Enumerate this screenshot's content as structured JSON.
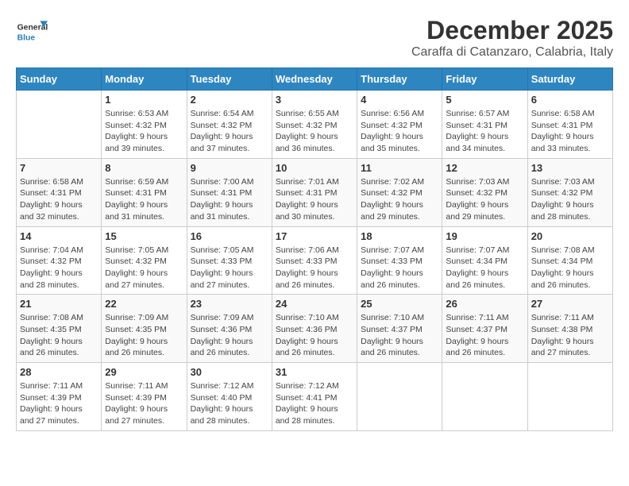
{
  "header": {
    "logo_general": "General",
    "logo_blue": "Blue",
    "title": "December 2025",
    "subtitle": "Caraffa di Catanzaro, Calabria, Italy"
  },
  "days_of_week": [
    "Sunday",
    "Monday",
    "Tuesday",
    "Wednesday",
    "Thursday",
    "Friday",
    "Saturday"
  ],
  "weeks": [
    [
      {
        "day": "",
        "info": ""
      },
      {
        "day": "1",
        "info": "Sunrise: 6:53 AM\nSunset: 4:32 PM\nDaylight: 9 hours\nand 39 minutes."
      },
      {
        "day": "2",
        "info": "Sunrise: 6:54 AM\nSunset: 4:32 PM\nDaylight: 9 hours\nand 37 minutes."
      },
      {
        "day": "3",
        "info": "Sunrise: 6:55 AM\nSunset: 4:32 PM\nDaylight: 9 hours\nand 36 minutes."
      },
      {
        "day": "4",
        "info": "Sunrise: 6:56 AM\nSunset: 4:32 PM\nDaylight: 9 hours\nand 35 minutes."
      },
      {
        "day": "5",
        "info": "Sunrise: 6:57 AM\nSunset: 4:31 PM\nDaylight: 9 hours\nand 34 minutes."
      },
      {
        "day": "6",
        "info": "Sunrise: 6:58 AM\nSunset: 4:31 PM\nDaylight: 9 hours\nand 33 minutes."
      }
    ],
    [
      {
        "day": "7",
        "info": "Sunrise: 6:58 AM\nSunset: 4:31 PM\nDaylight: 9 hours\nand 32 minutes."
      },
      {
        "day": "8",
        "info": "Sunrise: 6:59 AM\nSunset: 4:31 PM\nDaylight: 9 hours\nand 31 minutes."
      },
      {
        "day": "9",
        "info": "Sunrise: 7:00 AM\nSunset: 4:31 PM\nDaylight: 9 hours\nand 31 minutes."
      },
      {
        "day": "10",
        "info": "Sunrise: 7:01 AM\nSunset: 4:31 PM\nDaylight: 9 hours\nand 30 minutes."
      },
      {
        "day": "11",
        "info": "Sunrise: 7:02 AM\nSunset: 4:32 PM\nDaylight: 9 hours\nand 29 minutes."
      },
      {
        "day": "12",
        "info": "Sunrise: 7:03 AM\nSunset: 4:32 PM\nDaylight: 9 hours\nand 29 minutes."
      },
      {
        "day": "13",
        "info": "Sunrise: 7:03 AM\nSunset: 4:32 PM\nDaylight: 9 hours\nand 28 minutes."
      }
    ],
    [
      {
        "day": "14",
        "info": "Sunrise: 7:04 AM\nSunset: 4:32 PM\nDaylight: 9 hours\nand 28 minutes."
      },
      {
        "day": "15",
        "info": "Sunrise: 7:05 AM\nSunset: 4:32 PM\nDaylight: 9 hours\nand 27 minutes."
      },
      {
        "day": "16",
        "info": "Sunrise: 7:05 AM\nSunset: 4:33 PM\nDaylight: 9 hours\nand 27 minutes."
      },
      {
        "day": "17",
        "info": "Sunrise: 7:06 AM\nSunset: 4:33 PM\nDaylight: 9 hours\nand 26 minutes."
      },
      {
        "day": "18",
        "info": "Sunrise: 7:07 AM\nSunset: 4:33 PM\nDaylight: 9 hours\nand 26 minutes."
      },
      {
        "day": "19",
        "info": "Sunrise: 7:07 AM\nSunset: 4:34 PM\nDaylight: 9 hours\nand 26 minutes."
      },
      {
        "day": "20",
        "info": "Sunrise: 7:08 AM\nSunset: 4:34 PM\nDaylight: 9 hours\nand 26 minutes."
      }
    ],
    [
      {
        "day": "21",
        "info": "Sunrise: 7:08 AM\nSunset: 4:35 PM\nDaylight: 9 hours\nand 26 minutes."
      },
      {
        "day": "22",
        "info": "Sunrise: 7:09 AM\nSunset: 4:35 PM\nDaylight: 9 hours\nand 26 minutes."
      },
      {
        "day": "23",
        "info": "Sunrise: 7:09 AM\nSunset: 4:36 PM\nDaylight: 9 hours\nand 26 minutes."
      },
      {
        "day": "24",
        "info": "Sunrise: 7:10 AM\nSunset: 4:36 PM\nDaylight: 9 hours\nand 26 minutes."
      },
      {
        "day": "25",
        "info": "Sunrise: 7:10 AM\nSunset: 4:37 PM\nDaylight: 9 hours\nand 26 minutes."
      },
      {
        "day": "26",
        "info": "Sunrise: 7:11 AM\nSunset: 4:37 PM\nDaylight: 9 hours\nand 26 minutes."
      },
      {
        "day": "27",
        "info": "Sunrise: 7:11 AM\nSunset: 4:38 PM\nDaylight: 9 hours\nand 27 minutes."
      }
    ],
    [
      {
        "day": "28",
        "info": "Sunrise: 7:11 AM\nSunset: 4:39 PM\nDaylight: 9 hours\nand 27 minutes."
      },
      {
        "day": "29",
        "info": "Sunrise: 7:11 AM\nSunset: 4:39 PM\nDaylight: 9 hours\nand 27 minutes."
      },
      {
        "day": "30",
        "info": "Sunrise: 7:12 AM\nSunset: 4:40 PM\nDaylight: 9 hours\nand 28 minutes."
      },
      {
        "day": "31",
        "info": "Sunrise: 7:12 AM\nSunset: 4:41 PM\nDaylight: 9 hours\nand 28 minutes."
      },
      {
        "day": "",
        "info": ""
      },
      {
        "day": "",
        "info": ""
      },
      {
        "day": "",
        "info": ""
      }
    ]
  ]
}
